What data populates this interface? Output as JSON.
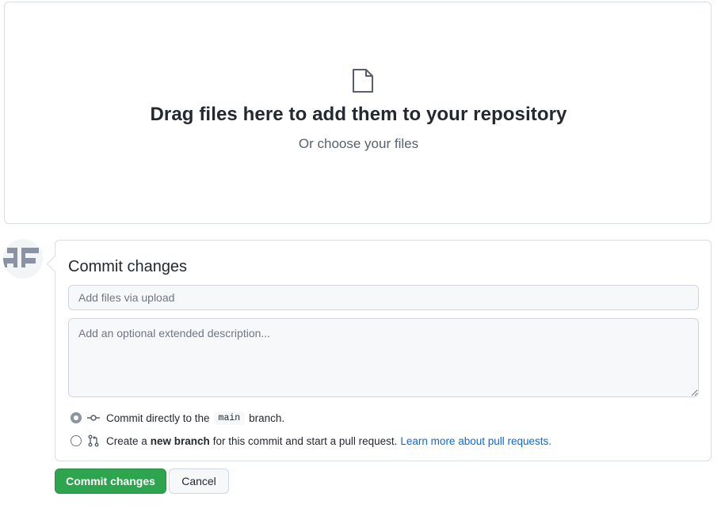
{
  "dropzone": {
    "icon": "file-icon",
    "title": "Drag files here to add them to your repository",
    "subtitle": "Or choose your files"
  },
  "avatar": {
    "icon": "identicon-avatar"
  },
  "commit": {
    "title": "Commit changes",
    "summary_placeholder": "Add files via upload",
    "description_placeholder": "Add an optional extended description...",
    "option_direct": {
      "prefix": "Commit directly to the",
      "branch": "main",
      "suffix": "branch.",
      "icon": "git-commit-icon",
      "selected": true
    },
    "option_new_branch": {
      "prefix": "Create a",
      "bold": "new branch",
      "suffix": "for this commit and start a pull request.",
      "link": "Learn more about pull requests.",
      "icon": "git-pull-request-icon",
      "selected": false
    }
  },
  "actions": {
    "commit_label": "Commit changes",
    "cancel_label": "Cancel"
  },
  "colors": {
    "primary_button": "#2da44e",
    "link": "#0969da",
    "border": "#d0d7de"
  }
}
